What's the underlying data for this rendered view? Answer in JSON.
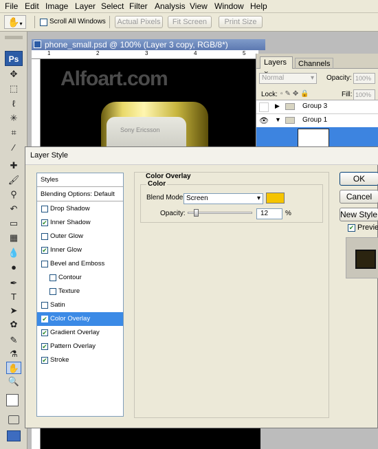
{
  "menu": [
    "File",
    "Edit",
    "Image",
    "Layer",
    "Select",
    "Filter",
    "Analysis",
    "View",
    "Window",
    "Help"
  ],
  "options": {
    "scroll_all_windows": "Scroll All Windows",
    "actual_pixels": "Actual Pixels",
    "fit_screen": "Fit Screen",
    "print_size": "Print Size"
  },
  "tools": {
    "ps_badge": "Ps"
  },
  "document": {
    "title": "phone_small.psd @ 100% (Layer 3 copy, RGB/8*)",
    "ruler_marks": [
      "1",
      "2",
      "3",
      "4",
      "5"
    ],
    "watermark": "Alfoart.com",
    "phone_brand": "Sony Ericsson"
  },
  "layers_panel": {
    "tabs": [
      "Layers",
      "Channels"
    ],
    "blend_mode": "Normal",
    "opacity_label": "Opacity:",
    "opacity_value": "100%",
    "lock_label": "Lock:",
    "fill_label": "Fill:",
    "fill_value": "100%",
    "layers": [
      {
        "name": "Group 3"
      },
      {
        "name": "Group 1"
      }
    ]
  },
  "dialog": {
    "title": "Layer Style",
    "styles_list": [
      {
        "label": "Styles",
        "checkbox": null,
        "header": true
      },
      {
        "label": "Blending Options: Default",
        "checkbox": null,
        "header": true
      },
      {
        "label": "Drop Shadow",
        "checked": false
      },
      {
        "label": "Inner Shadow",
        "checked": true
      },
      {
        "label": "Outer Glow",
        "checked": false
      },
      {
        "label": "Inner Glow",
        "checked": true
      },
      {
        "label": "Bevel and Emboss",
        "checked": false
      },
      {
        "label": "Contour",
        "checked": false,
        "indent": true
      },
      {
        "label": "Texture",
        "checked": false,
        "indent": true
      },
      {
        "label": "Satin",
        "checked": false
      },
      {
        "label": "Color Overlay",
        "checked": true,
        "selected": true
      },
      {
        "label": "Gradient Overlay",
        "checked": true
      },
      {
        "label": "Pattern Overlay",
        "checked": true
      },
      {
        "label": "Stroke",
        "checked": true
      }
    ],
    "section_title": "Color Overlay",
    "group_title": "Color",
    "blend_mode_label": "Blend Mode:",
    "blend_mode_value": "Screen",
    "overlay_color": "#f5c400",
    "opacity_label": "Opacity:",
    "opacity_value": "12",
    "opacity_unit": "%",
    "opacity_fraction": 0.12,
    "buttons": {
      "ok": "OK",
      "cancel": "Cancel",
      "new_style": "New Style...",
      "preview": "Preview"
    },
    "preview_checked": true
  }
}
